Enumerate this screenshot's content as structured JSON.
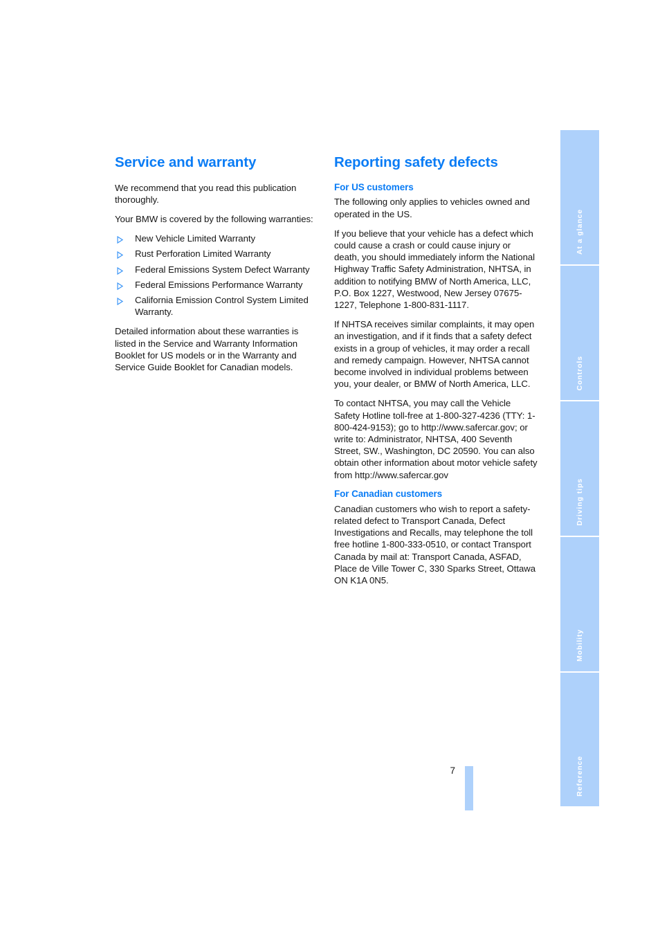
{
  "page": {
    "number": "7",
    "accent_blue": "#0a7cf5",
    "tab_blue": "#aed1fb"
  },
  "left_column": {
    "title": "Service and warranty",
    "intro_paragraphs": [
      "We recommend that you read this publication thoroughly.",
      "Your BMW is covered by the following warranties:"
    ],
    "warranties": [
      "New Vehicle Limited Warranty",
      "Rust Perforation Limited Warranty",
      "Federal Emissions System Defect Warranty",
      "Federal Emissions Performance Warranty",
      "California Emission Control System Limited Warranty."
    ],
    "closing_paragraph": "Detailed information about these warranties is listed in the Service and Warranty Information Booklet for US models or in the Warranty and Service Guide Booklet for Canadian models."
  },
  "right_column": {
    "title": "Reporting safety defects",
    "us": {
      "heading": "For US customers",
      "paragraphs": [
        "The following only applies to vehicles owned and operated in the US.",
        "If you believe that your vehicle has a defect which could cause a crash or could cause injury or death, you should immediately inform the National Highway Traffic Safety Administration, NHTSA, in addition to notifying BMW of North America, LLC, P.O. Box 1227, Westwood, New Jersey 07675-1227, Telephone 1-800-831-1117.",
        "If NHTSA receives similar complaints, it may open an investigation, and if it finds that a safety defect exists in a group of vehicles, it may order a recall and remedy campaign. However, NHTSA cannot become involved in individual problems between you, your dealer, or BMW of North America, LLC.",
        "To contact NHTSA, you may call the Vehicle Safety Hotline toll-free at 1-800-327-4236 (TTY: 1-800-424-9153); go to http://www.safercar.gov; or write to: Administrator, NHTSA, 400 Seventh Street, SW., Washington, DC 20590. You can also obtain other information about motor vehicle safety from http://www.safercar.gov"
      ]
    },
    "canada": {
      "heading": "For Canadian customers",
      "paragraphs": [
        "Canadian customers who wish to report a safety-related defect to Transport Canada, Defect Investigations and Recalls, may telephone the toll free hotline 1-800-333-0510, or contact Transport Canada by mail at: Transport Canada, ASFAD, Place de Ville Tower C, 330 Sparks Street, Ottawa ON K1A 0N5."
      ]
    }
  },
  "tabs": [
    {
      "label": "At a glance"
    },
    {
      "label": "Controls"
    },
    {
      "label": "Driving tips"
    },
    {
      "label": "Mobility"
    },
    {
      "label": "Reference"
    }
  ]
}
